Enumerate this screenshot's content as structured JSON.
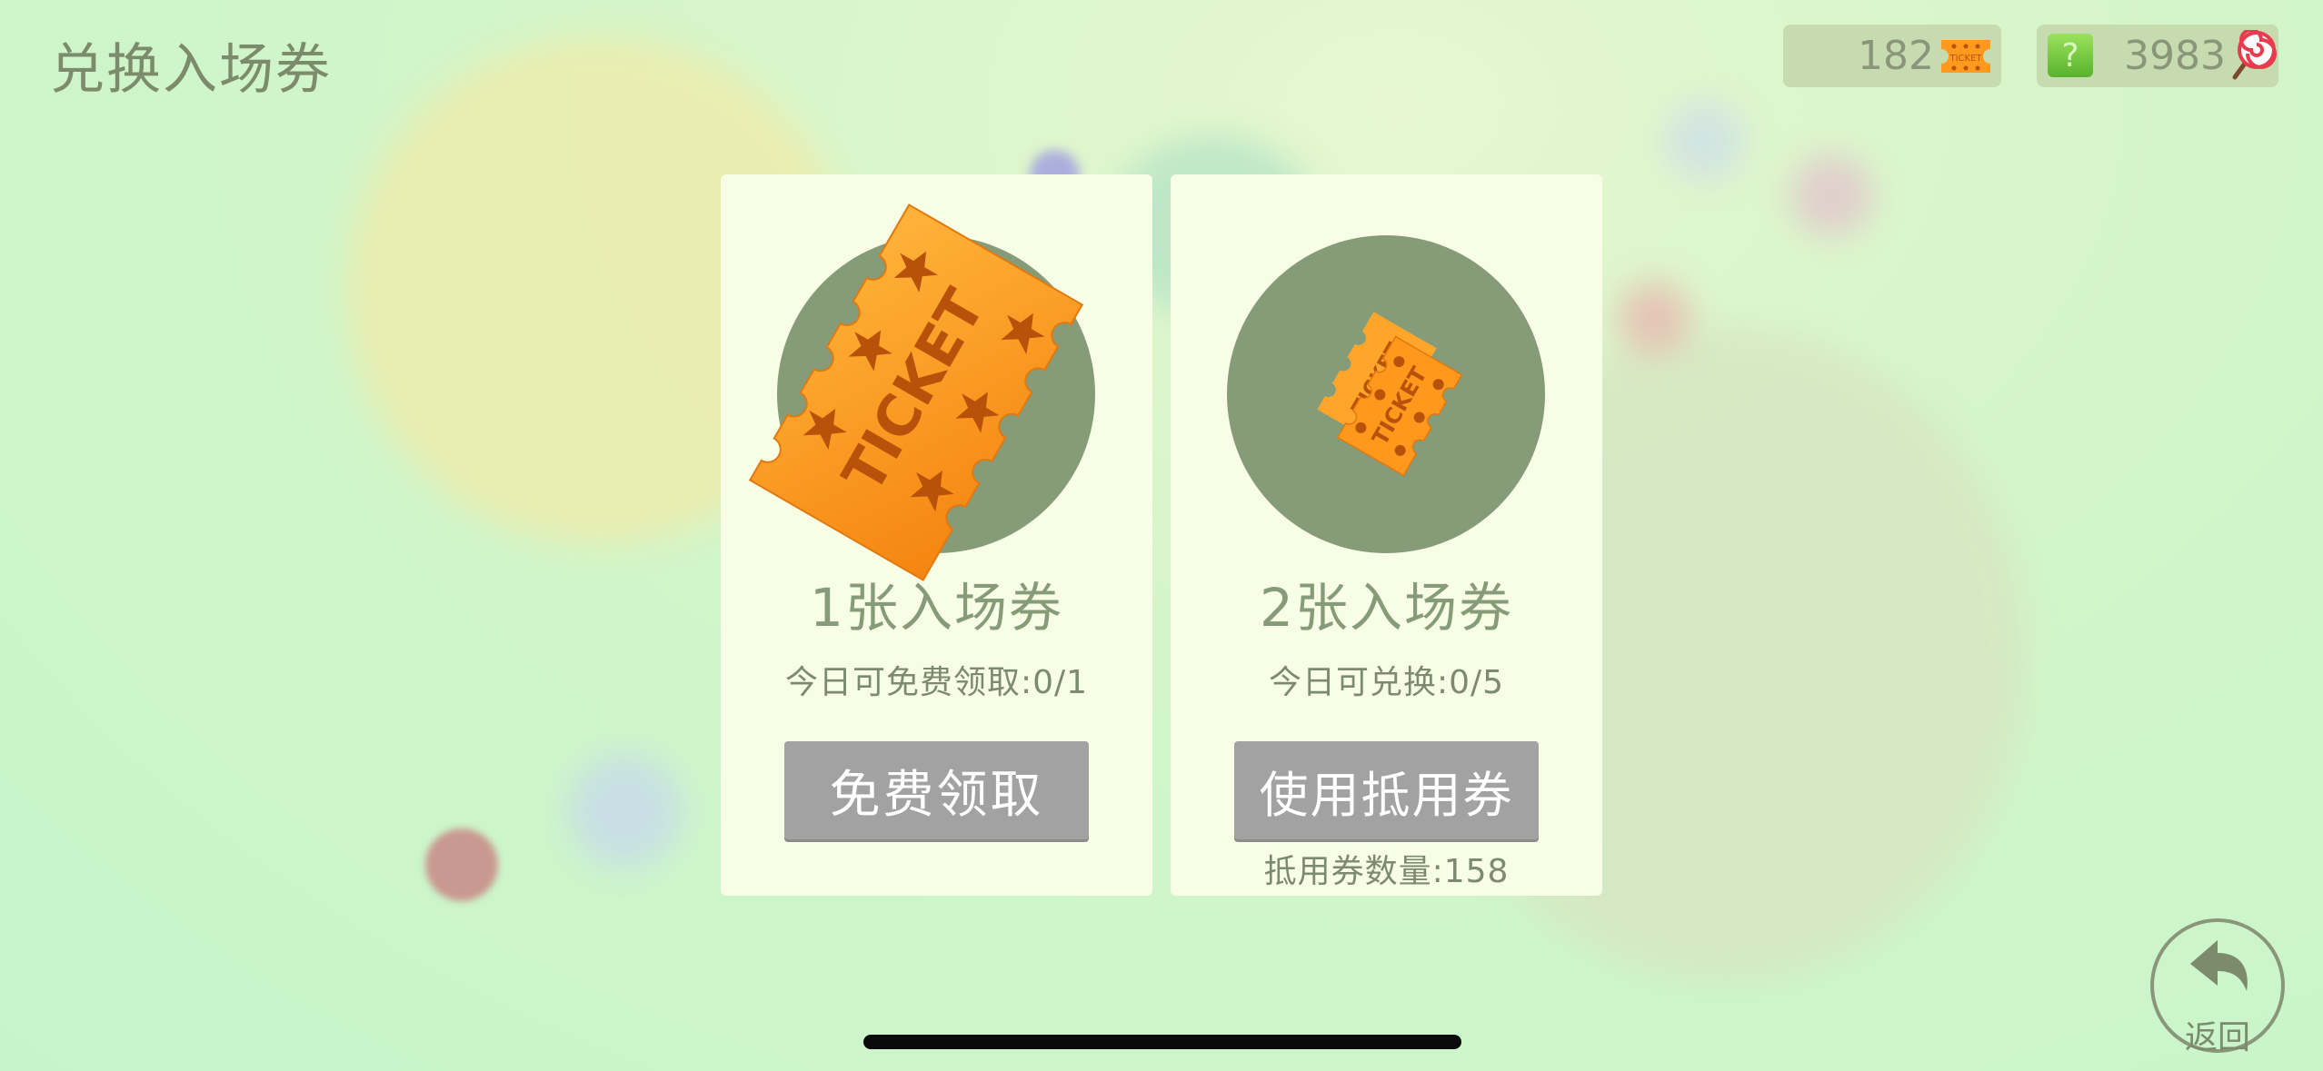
{
  "header": {
    "title": "兑换入场券",
    "tickets": {
      "count": "182",
      "icon": "ticket-icon",
      "icon_text": "TICKET"
    },
    "candy": {
      "count": "3983",
      "icon": "lollipop-icon",
      "help_icon": "help-icon",
      "help_glyph": "?"
    }
  },
  "cards": [
    {
      "title": "1张入场券",
      "subtitle": "今日可免费领取:0/1",
      "button_label": "免费领取",
      "image": "ticket-large-icon",
      "image_text": "TICKET"
    },
    {
      "title": "2张入场券",
      "subtitle": "今日可兑换:0/5",
      "button_label": "使用抵用券",
      "footer": "抵用券数量:158",
      "image": "two-tickets-icon",
      "image_text": "TICKET"
    }
  ],
  "back": {
    "label": "返回",
    "icon": "return-arrow-icon"
  },
  "colors": {
    "card_bg": "#f8fde6",
    "circle": "#869b77",
    "button": "#a2a2a2",
    "ticket_orange": "#ff9a1e",
    "text": "#7b8b6c"
  }
}
